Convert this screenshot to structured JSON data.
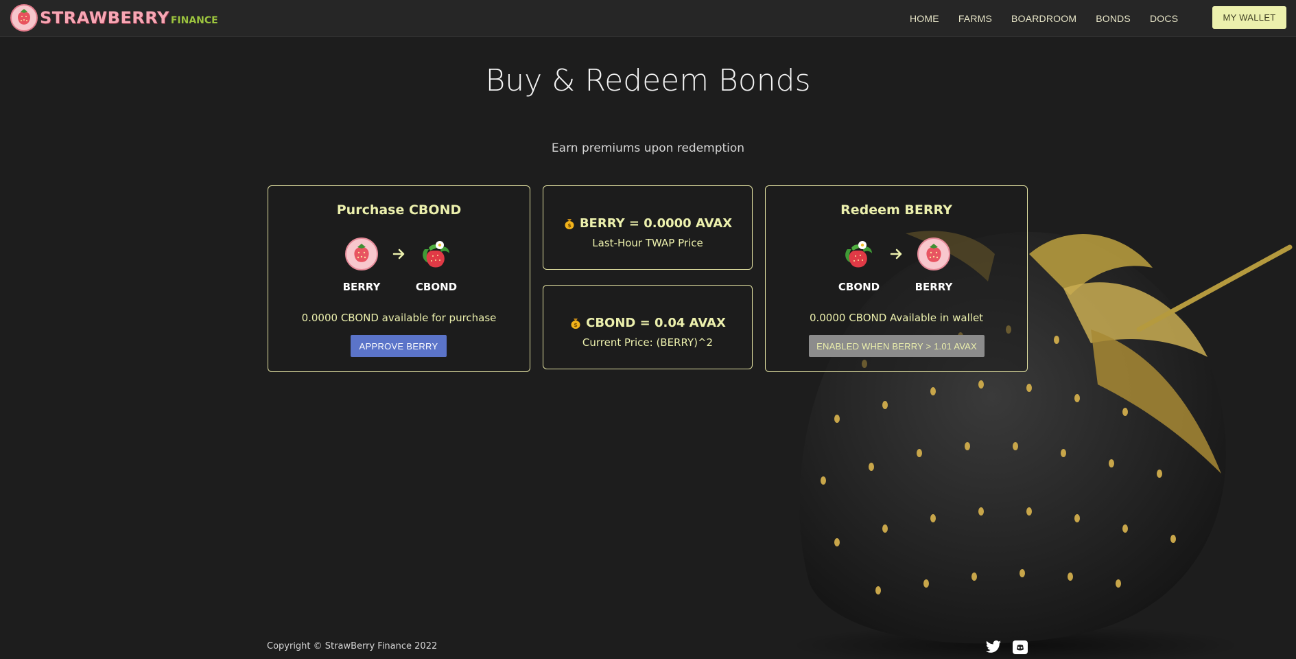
{
  "brand": {
    "name": "STRAWBERRY",
    "suffix": "FINANCE"
  },
  "nav": {
    "items": [
      {
        "label": "HOME"
      },
      {
        "label": "FARMS"
      },
      {
        "label": "BOARDROOM"
      },
      {
        "label": "BONDS"
      },
      {
        "label": "DOCS"
      }
    ],
    "wallet_label": "MY WALLET"
  },
  "header": {
    "title": "Buy & Redeem Bonds",
    "subtitle": "Earn premiums upon redemption"
  },
  "purchase_card": {
    "title": "Purchase CBOND",
    "from_token": "BERRY",
    "to_token": "CBOND",
    "info": "0.0000 CBOND available for purchase",
    "button_label": "APPROVE BERRY"
  },
  "berry_price_card": {
    "price": "BERRY = 0.0000 AVAX",
    "caption": "Last-Hour TWAP Price"
  },
  "cbond_price_card": {
    "price": "CBOND = 0.04 AVAX",
    "caption": "Current Price: (BERRY)^2"
  },
  "redeem_card": {
    "title": "Redeem BERRY",
    "from_token": "CBOND",
    "to_token": "BERRY",
    "info": "0.0000 CBOND Available in wallet",
    "button_label": "ENABLED WHEN BERRY > 1.01 AVAX"
  },
  "footer": {
    "copyright": "Copyright © StrawBerry Finance 2022",
    "social": [
      "twitter-icon",
      "discord-icon"
    ]
  },
  "colors": {
    "background": "#1d1d1d",
    "navbar": "#262626",
    "accent": "#ecf0ad",
    "card_border": "#e3e2a2",
    "approve_button": "#5b74c9",
    "disabled_button": "#8c8c8c",
    "berry_pink": "#f7a6b4",
    "finance_green": "#9cc43e"
  }
}
